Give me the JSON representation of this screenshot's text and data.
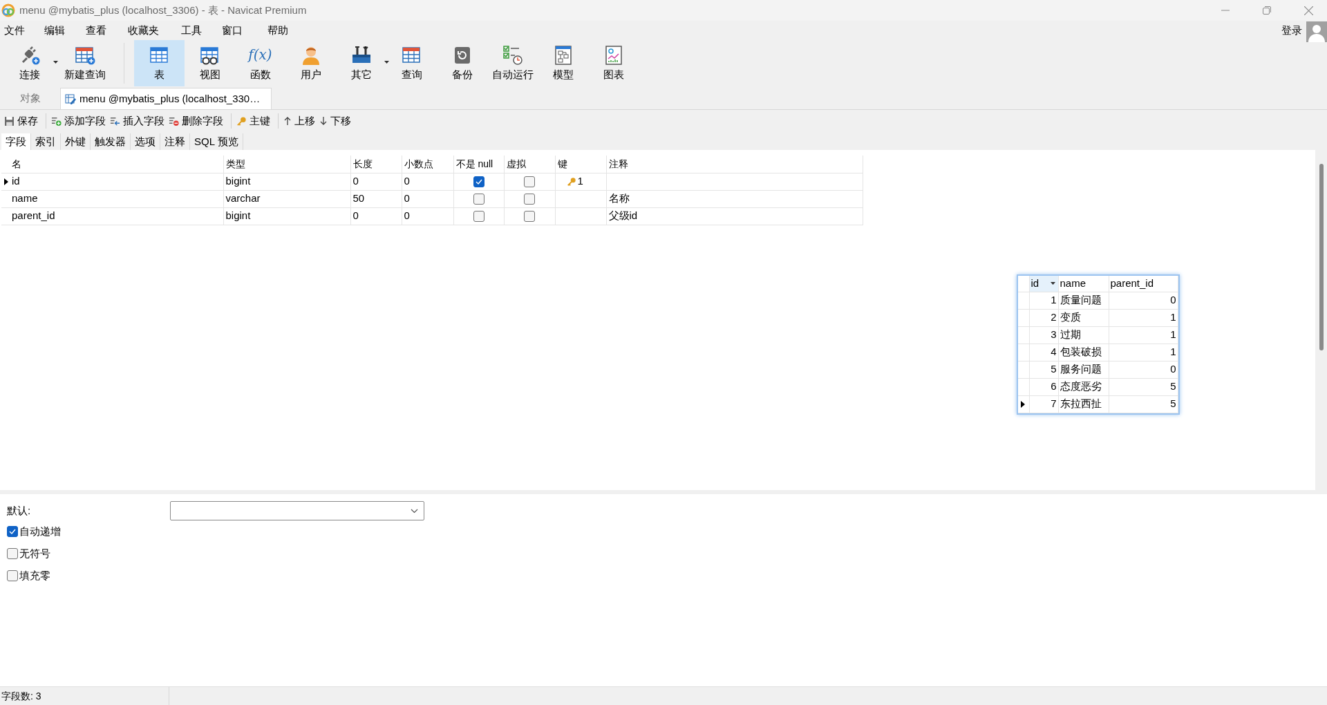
{
  "window": {
    "title": "menu @mybatis_plus (localhost_3306) - 表 - Navicat Premium"
  },
  "menu": [
    "文件",
    "编辑",
    "查看",
    "收藏夹",
    "工具",
    "窗口",
    "帮助"
  ],
  "account": {
    "label": "登录"
  },
  "toolbar": [
    {
      "label": "连接",
      "selected": false,
      "dropdown": true
    },
    {
      "label": "新建查询",
      "selected": false,
      "dropdown": false
    },
    {
      "label": "表",
      "selected": true,
      "dropdown": false
    },
    {
      "label": "视图",
      "selected": false,
      "dropdown": false
    },
    {
      "label": "函数",
      "selected": false,
      "dropdown": false,
      "icon_text": "f(x)"
    },
    {
      "label": "用户",
      "selected": false,
      "dropdown": false
    },
    {
      "label": "其它",
      "selected": false,
      "dropdown": true
    },
    {
      "label": "查询",
      "selected": false,
      "dropdown": false
    },
    {
      "label": "备份",
      "selected": false,
      "dropdown": false
    },
    {
      "label": "自动运行",
      "selected": false,
      "dropdown": false
    },
    {
      "label": "模型",
      "selected": false,
      "dropdown": false
    },
    {
      "label": "图表",
      "selected": false,
      "dropdown": false
    }
  ],
  "tabs": [
    {
      "label": "对象",
      "selected": false
    },
    {
      "label": "menu @mybatis_plus (localhost_330…",
      "selected": true
    }
  ],
  "actions": [
    {
      "label": "保存"
    },
    {
      "label": "添加字段"
    },
    {
      "label": "插入字段"
    },
    {
      "label": "删除字段"
    },
    {
      "label": "主键"
    },
    {
      "label": "上移"
    },
    {
      "label": "下移"
    }
  ],
  "subtabs": [
    {
      "label": "字段",
      "selected": true
    },
    {
      "label": "索引",
      "selected": false
    },
    {
      "label": "外键",
      "selected": false
    },
    {
      "label": "触发器",
      "selected": false
    },
    {
      "label": "选项",
      "selected": false
    },
    {
      "label": "注释",
      "selected": false
    },
    {
      "label": "SQL 预览",
      "selected": false
    }
  ],
  "fields": {
    "columns": [
      "名",
      "类型",
      "长度",
      "小数点",
      "不是 null",
      "虚拟",
      "键",
      "注释"
    ],
    "rows": [
      {
        "name": "id",
        "type": "bigint",
        "length": "0",
        "decimals": "0",
        "not_null": true,
        "virtual": false,
        "key": "1",
        "selected": true
      },
      {
        "name": "name",
        "type": "varchar",
        "length": "50",
        "decimals": "0",
        "not_null": false,
        "virtual": false,
        "comment": "名称",
        "selected": false
      },
      {
        "name": "parent_id",
        "type": "bigint",
        "length": "0",
        "decimals": "0",
        "not_null": false,
        "virtual": false,
        "comment": "父级id",
        "selected": false
      }
    ]
  },
  "result_grid": {
    "columns": [
      "id",
      "name",
      "parent_id"
    ],
    "rows": [
      {
        "id": "1",
        "name": "质量问题",
        "parent_id": "0",
        "selected": false
      },
      {
        "id": "2",
        "name": "变质",
        "parent_id": "1",
        "selected": false
      },
      {
        "id": "3",
        "name": "过期",
        "parent_id": "1",
        "selected": false
      },
      {
        "id": "4",
        "name": "包装破损",
        "parent_id": "1",
        "selected": false
      },
      {
        "id": "5",
        "name": "服务问题",
        "parent_id": "0",
        "selected": false
      },
      {
        "id": "6",
        "name": "态度恶劣",
        "parent_id": "5",
        "selected": false
      },
      {
        "id": "7",
        "name": "东拉西扯",
        "parent_id": "5",
        "selected": true
      }
    ]
  },
  "properties": {
    "default_label": "默认:",
    "options": [
      {
        "label": "自动递增",
        "checked": true
      },
      {
        "label": "无符号",
        "checked": false
      },
      {
        "label": "填充零",
        "checked": false
      }
    ]
  },
  "status_bar": {
    "text": "字段数: 3"
  }
}
